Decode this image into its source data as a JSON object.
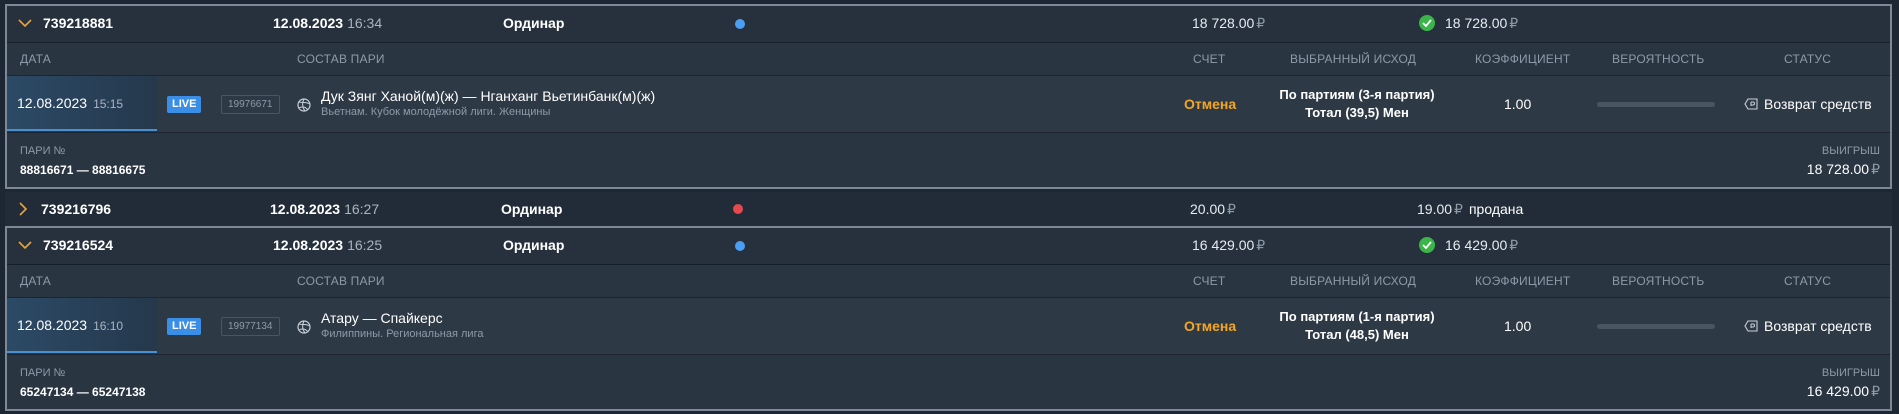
{
  "columns": {
    "date": "ДАТА",
    "pairs": "СОСТАВ ПАРИ",
    "score": "СЧЕТ",
    "outcome": "ВЫБРАННЫЙ ИСХОД",
    "coef": "КОЭФФИЦИЕНТ",
    "prob": "ВЕРОЯТНОСТЬ",
    "status": "СТАТУС"
  },
  "footer_labels": {
    "pairs_no": "ПАРИ №",
    "win": "ВЫИГРЫШ"
  },
  "currency": "₽",
  "colors": {
    "dot_blue": "#4a9ff5",
    "dot_red": "#e5484d",
    "check": "#3bb54a",
    "score": "#f5a623"
  },
  "bets": [
    {
      "id": "739218881",
      "date": "12.08.2023",
      "time": "16:34",
      "type": "Ординар",
      "dot": "blue",
      "stake": "18 728.00",
      "payout": "18 728.00",
      "payout_icon": "check-icon",
      "expanded": true,
      "event": {
        "date": "12.08.2023",
        "time": "15:15",
        "live": "LIVE",
        "code": "19976671",
        "sport_icon": "volleyball-icon",
        "teams": "Дук Зянг Ханой(м)(ж) — Нганханг Вьетинбанк(м)(ж)",
        "league": "Вьетнам. Кубок молодёжной лиги. Женщины",
        "score": "Отмена",
        "outcome_line1": "По партиям (3-я партия)",
        "outcome_line2": "Тотал (39,5) Мен",
        "coef": "1.00",
        "status": "Возврат средств"
      },
      "pairs_no": "88816671 — 88816675",
      "win": "18 728.00"
    },
    {
      "id": "739216796",
      "date": "12.08.2023",
      "time": "16:27",
      "type": "Ординар",
      "dot": "red",
      "stake": "20.00",
      "payout": "19.00",
      "sold": "продана",
      "expanded": false
    },
    {
      "id": "739216524",
      "date": "12.08.2023",
      "time": "16:25",
      "type": "Ординар",
      "dot": "blue",
      "stake": "16 429.00",
      "payout": "16 429.00",
      "payout_icon": "check-icon",
      "expanded": true,
      "event": {
        "date": "12.08.2023",
        "time": "16:10",
        "live": "LIVE",
        "code": "19977134",
        "sport_icon": "volleyball-icon",
        "teams": "Атару — Спайкерс",
        "league": "Филиппины. Региональная лига",
        "score": "Отмена",
        "outcome_line1": "По партиям (1-я партия)",
        "outcome_line2": "Тотал (48,5) Мен",
        "coef": "1.00",
        "status": "Возврат средств"
      },
      "pairs_no": "65247134 — 65247138",
      "win": "16 429.00"
    }
  ]
}
